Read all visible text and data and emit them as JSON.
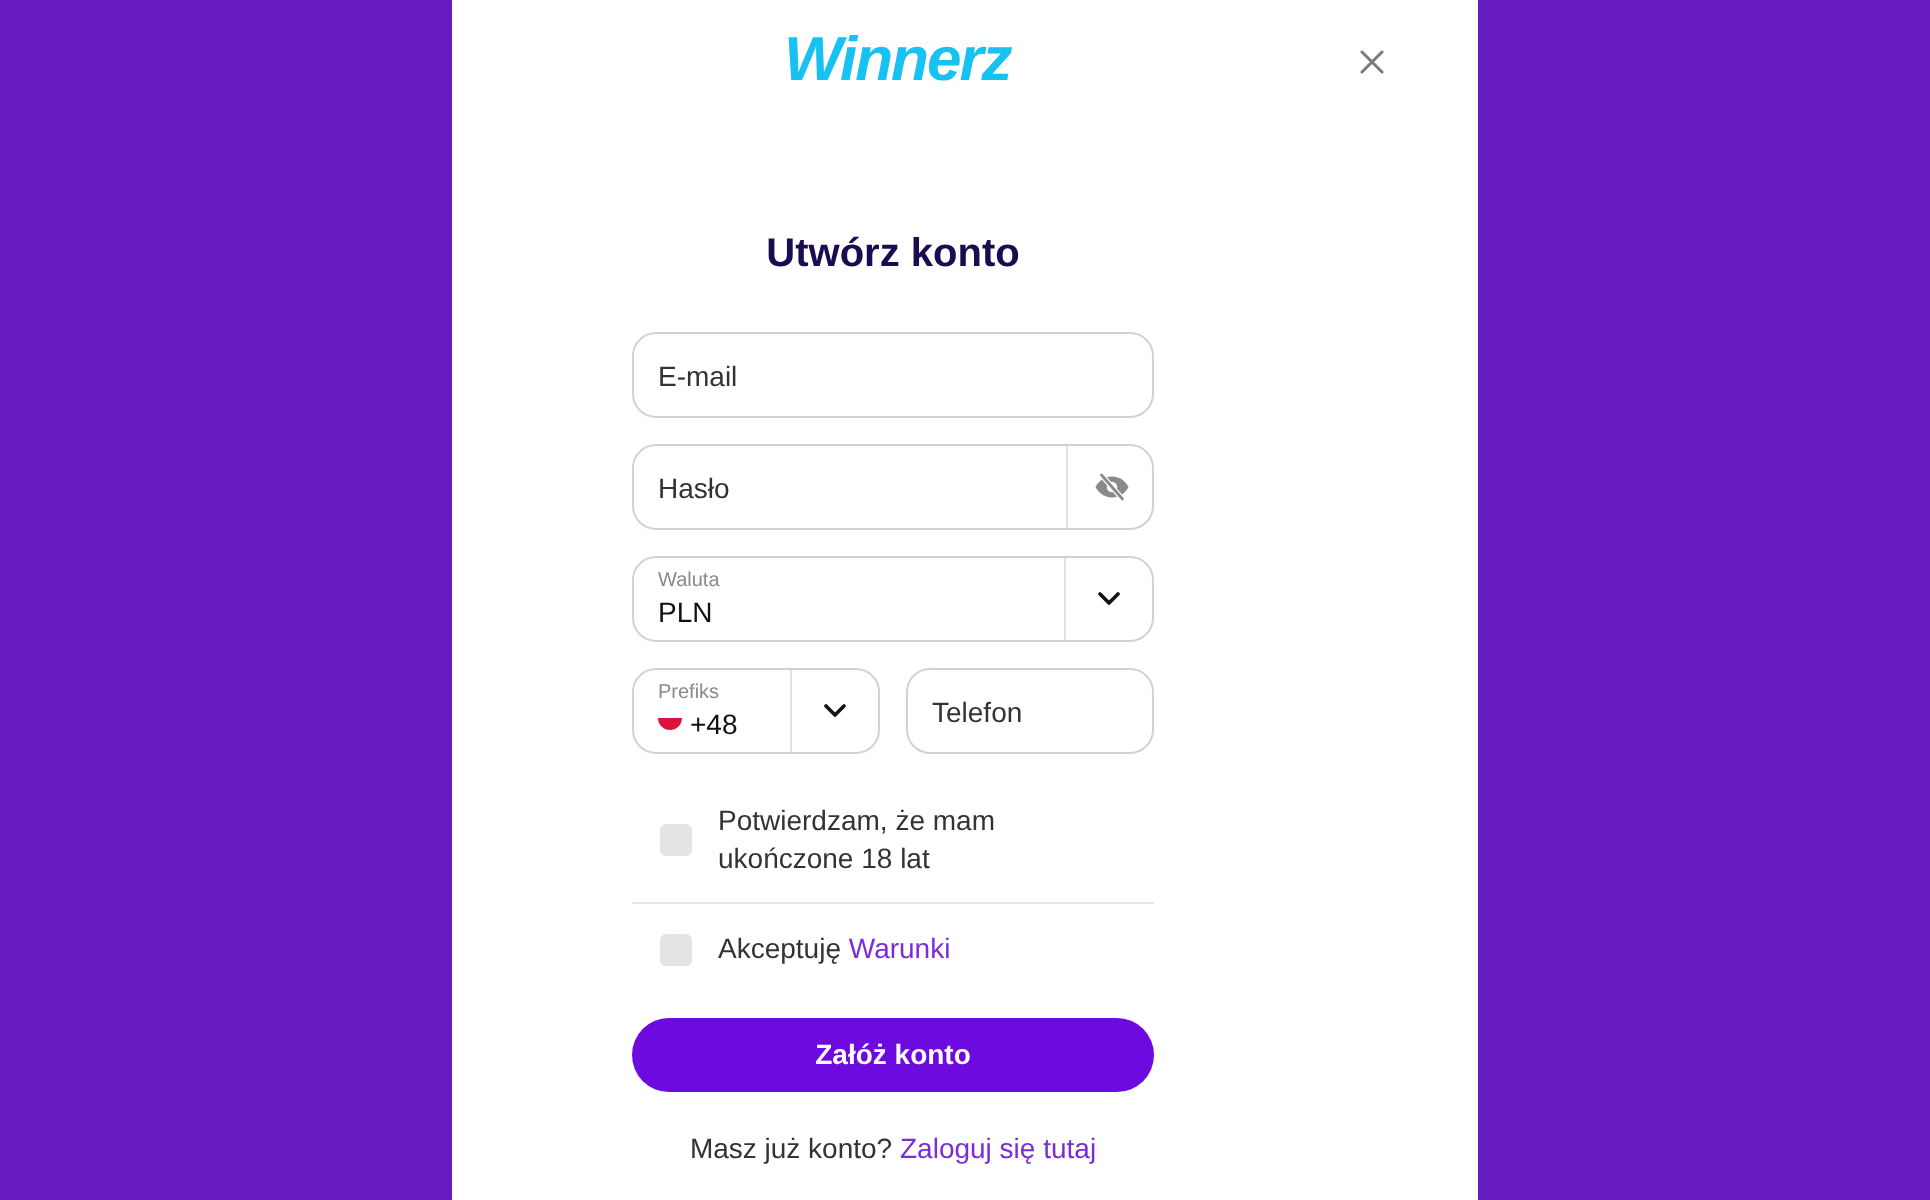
{
  "logo": {
    "text": "Winnerz"
  },
  "title": "Utwórz konto",
  "fields": [
    {
      "kind": "email",
      "placeholder": "E-mail"
    },
    {
      "kind": "password",
      "placeholder": "Hasło"
    },
    {
      "kind": "select",
      "label": "Waluta",
      "value": "PLN"
    }
  ],
  "phone": {
    "prefix": {
      "label": "Prefiks",
      "value": "+48"
    },
    "number": {
      "placeholder": "Telefon"
    }
  },
  "checkboxes": [
    {
      "text": "Potwierdzam, że mam ukończone 18 lat",
      "checked": false
    },
    {
      "text": "Akceptuję",
      "link": "Warunki",
      "checked": false
    }
  ],
  "submit_button": {
    "label": "Załóż konto"
  },
  "footer": {
    "text": "Masz już konto?",
    "link": "Zaloguj się tutaj"
  }
}
